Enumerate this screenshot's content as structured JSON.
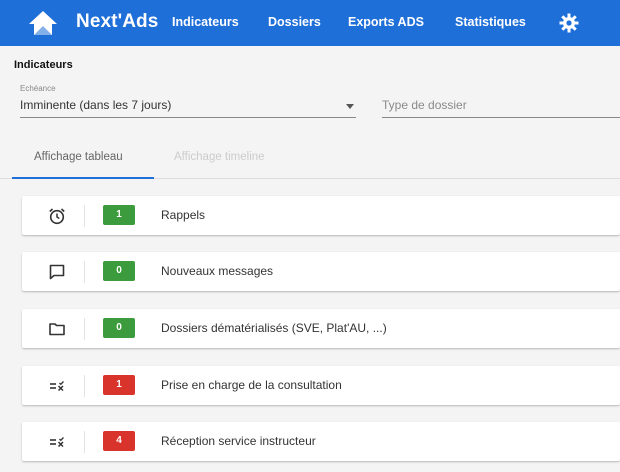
{
  "header": {
    "app_name": "Next'Ads",
    "nav": [
      "Indicateurs",
      "Dossiers",
      "Exports ADS",
      "Statistiques"
    ],
    "settings_icon": "gear-icon",
    "logo_icon": "house-logo-icon",
    "background_color": "#1f6fd9"
  },
  "page": {
    "title": "Indicateurs",
    "filters": {
      "echeance_label": "Echéance",
      "echeance_value": "Imminente (dans les 7 jours)",
      "type_placeholder": "Type de dossier"
    },
    "tabs": [
      {
        "label": "Affichage tableau",
        "active": true
      },
      {
        "label": "Affichage timeline",
        "active": false
      }
    ]
  },
  "indicators": [
    {
      "icon": "alarm-clock-icon",
      "count": "1",
      "color": "#3c9b3c",
      "label": "Rappels"
    },
    {
      "icon": "message-icon",
      "count": "0",
      "color": "#3c9b3c",
      "label": "Nouveaux messages"
    },
    {
      "icon": "folder-icon",
      "count": "0",
      "color": "#3c9b3c",
      "label": "Dossiers dématérialisés (SVE, Plat'AU, ...)"
    },
    {
      "icon": "list-check-icon",
      "count": "1",
      "color": "#d9342b",
      "label": "Prise en charge de la consultation"
    },
    {
      "icon": "list-check-icon",
      "count": "4",
      "color": "#d9342b",
      "label": "Réception service instructeur"
    }
  ]
}
